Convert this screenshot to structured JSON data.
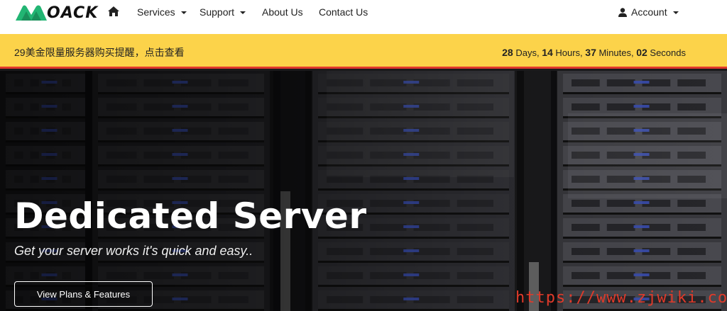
{
  "brand": {
    "logo_text": "OACK"
  },
  "nav": {
    "services": "Services",
    "support": "Support",
    "about": "About Us",
    "contact": "Contact Us",
    "account": "Account"
  },
  "promo": {
    "text": "29美金限量服务器购买提醒，点击查看",
    "days": "28",
    "days_label": " Days, ",
    "hours": "14",
    "hours_label": " Hours, ",
    "minutes": "37",
    "minutes_label": " Minutes, ",
    "seconds": "02",
    "seconds_label": " Seconds"
  },
  "hero": {
    "title": "Dedicated Server",
    "subtitle": "Get your server works it's quick and easy..",
    "button": "View Plans & Features"
  },
  "watermark": "https://www.zjwiki.com",
  "colors": {
    "promo_bg": "#fcd34a",
    "promo_border": "#e0392c",
    "logo_green": "#22b573",
    "watermark": "#e03a2a"
  },
  "icons": {
    "home": "home-icon",
    "user": "user-icon",
    "logo": "logo-mark-icon"
  }
}
